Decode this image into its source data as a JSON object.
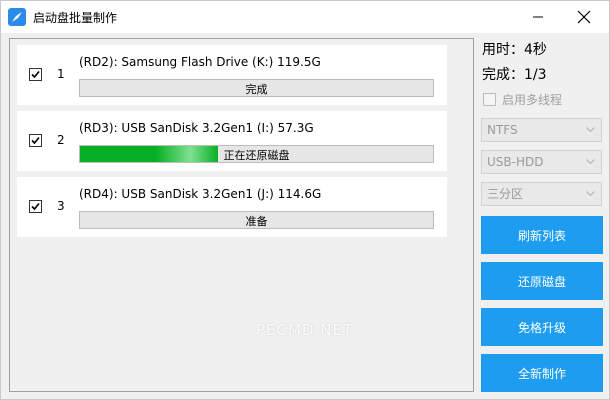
{
  "window": {
    "title": "启动盘批量制作"
  },
  "devices": [
    {
      "index": "1",
      "checked": true,
      "label": "(RD2): Samsung Flash Drive (K:) 119.5G",
      "status": "完成",
      "progress": 0
    },
    {
      "index": "2",
      "checked": true,
      "label": "(RD3): USB SanDisk 3.2Gen1 (I:) 57.3G",
      "status": "正在还原磁盘",
      "progress": 0.39
    },
    {
      "index": "3",
      "checked": true,
      "label": "(RD4): USB SanDisk 3.2Gen1 (J:) 114.6G",
      "status": "准备",
      "progress": 0
    }
  ],
  "side": {
    "elapsed": "用时：4秒",
    "done": "完成：1/3",
    "multithread_label": "启用多线程",
    "filesystem": "NTFS",
    "mode": "USB-HDD",
    "partition": "三分区"
  },
  "buttons": {
    "refresh": "刷新列表",
    "restore": "还原磁盘",
    "upgrade": "免格升级",
    "create": "全新制作"
  },
  "watermark": "PECMD.NET",
  "colors": {
    "accent": "#1e9df0",
    "progress": "#06b025"
  }
}
